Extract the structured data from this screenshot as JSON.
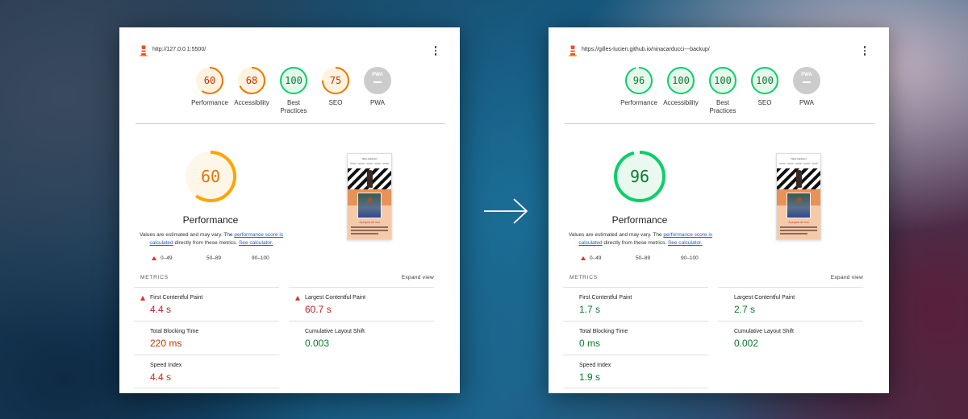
{
  "left_report": {
    "url": "http://127.0.0.1:5500/",
    "scores": [
      {
        "label": "Performance",
        "value": "60",
        "fraction": 0.6,
        "color": "#e67700",
        "bg": "#fff3e0"
      },
      {
        "label": "Accessibility",
        "value": "68",
        "fraction": 0.68,
        "color": "#e67700",
        "bg": "#fff3e0"
      },
      {
        "label": "Best Practices",
        "value": "100",
        "fraction": 1.0,
        "color": "#0cce6b",
        "bg": "#e6f8ec"
      },
      {
        "label": "SEO",
        "value": "75",
        "fraction": 0.75,
        "color": "#e67700",
        "bg": "#fff3e0"
      },
      {
        "label": "PWA",
        "value": "PWA",
        "fraction": 0,
        "color": "#cccccc",
        "bg": "#cccccc"
      }
    ],
    "performance": {
      "score": "60",
      "fraction": 0.6,
      "color": "#ffa400",
      "bg": "#fff6ea",
      "title": "Performance",
      "desc_prefix": "Values are estimated and may vary. The ",
      "desc_link1": "performance score is calculated",
      "desc_mid": " directly from these metrics. ",
      "desc_link2": "See calculator."
    },
    "legend": [
      "0–49",
      "50–89",
      "90–100"
    ],
    "metrics_header": "METRICS",
    "expand_view": "Expand view",
    "metrics": [
      {
        "name": "First Contentful Paint",
        "value": "4.4 s",
        "status": "fail"
      },
      {
        "name": "Largest Contentful Paint",
        "value": "60.7 s",
        "status": "fail"
      },
      {
        "name": "Total Blocking Time",
        "value": "220 ms",
        "status": "average"
      },
      {
        "name": "Cumulative Layout Shift",
        "value": "0.003",
        "status": "pass"
      },
      {
        "name": "Speed Index",
        "value": "4.4 s",
        "status": "average"
      }
    ],
    "thumbnail": {
      "title": "Nina Carducci",
      "caption": "A propos de moi"
    }
  },
  "right_report": {
    "url": "https://gilles-lucien.github.io/ninacarducci---backup/",
    "scores": [
      {
        "label": "Performance",
        "value": "96",
        "fraction": 0.96,
        "color": "#0cce6b",
        "bg": "#e6f8ec"
      },
      {
        "label": "Accessibility",
        "value": "100",
        "fraction": 1.0,
        "color": "#0cce6b",
        "bg": "#e6f8ec"
      },
      {
        "label": "Best Practices",
        "value": "100",
        "fraction": 1.0,
        "color": "#0cce6b",
        "bg": "#e6f8ec"
      },
      {
        "label": "SEO",
        "value": "100",
        "fraction": 1.0,
        "color": "#0cce6b",
        "bg": "#e6f8ec"
      },
      {
        "label": "PWA",
        "value": "PWA",
        "fraction": 0,
        "color": "#cccccc",
        "bg": "#cccccc"
      }
    ],
    "performance": {
      "score": "96",
      "fraction": 0.96,
      "color": "#0cce6b",
      "bg": "#e9f9ef",
      "title": "Performance",
      "desc_prefix": "Values are estimated and may vary. The ",
      "desc_link1": "performance score is calculated",
      "desc_mid": " directly from these metrics. ",
      "desc_link2": "See calculator."
    },
    "legend": [
      "0–49",
      "50–89",
      "90–100"
    ],
    "metrics_header": "METRICS",
    "expand_view": "Expand view",
    "metrics": [
      {
        "name": "First Contentful Paint",
        "value": "1.7 s",
        "status": "pass"
      },
      {
        "name": "Largest Contentful Paint",
        "value": "2.7 s",
        "status": "pass"
      },
      {
        "name": "Total Blocking Time",
        "value": "0 ms",
        "status": "pass"
      },
      {
        "name": "Cumulative Layout Shift",
        "value": "0.002",
        "status": "pass"
      },
      {
        "name": "Speed Index",
        "value": "1.9 s",
        "status": "pass"
      }
    ],
    "thumbnail": {
      "title": "Nina Carducci",
      "caption": "A propos de moi"
    }
  },
  "arrow_icon": "arrow-right-icon",
  "status_colors": {
    "fail": "#c5221f",
    "average": "#c33300",
    "pass": "#0a7a30"
  }
}
